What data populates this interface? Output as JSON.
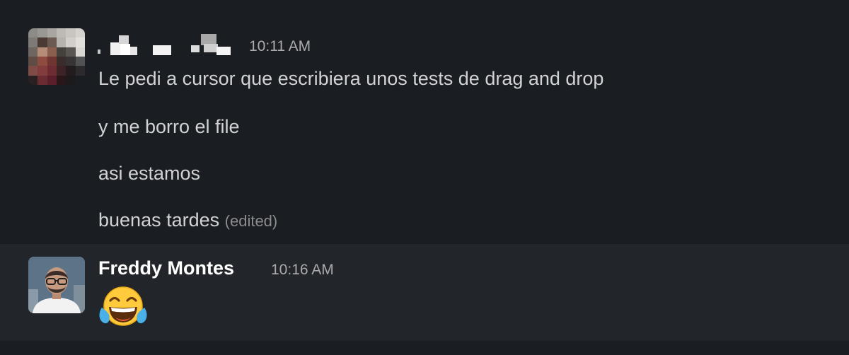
{
  "messages": [
    {
      "author": "",
      "author_redacted": true,
      "time": "10:11 AM",
      "lines": [
        "Le pedi a cursor que escribiera unos tests de drag and drop",
        "y me borro el file",
        "asi estamos",
        "buenas tardes"
      ],
      "edited_label": "(edited)"
    },
    {
      "author": "Freddy Montes",
      "time": "10:16 AM",
      "reaction_icon": "face-with-tears-of-joy-emoji"
    }
  ],
  "colors": {
    "background": "#1a1d21",
    "hover_background": "#222529",
    "text": "#d1d2d3",
    "username": "#ffffff",
    "timestamp": "#ababad"
  }
}
